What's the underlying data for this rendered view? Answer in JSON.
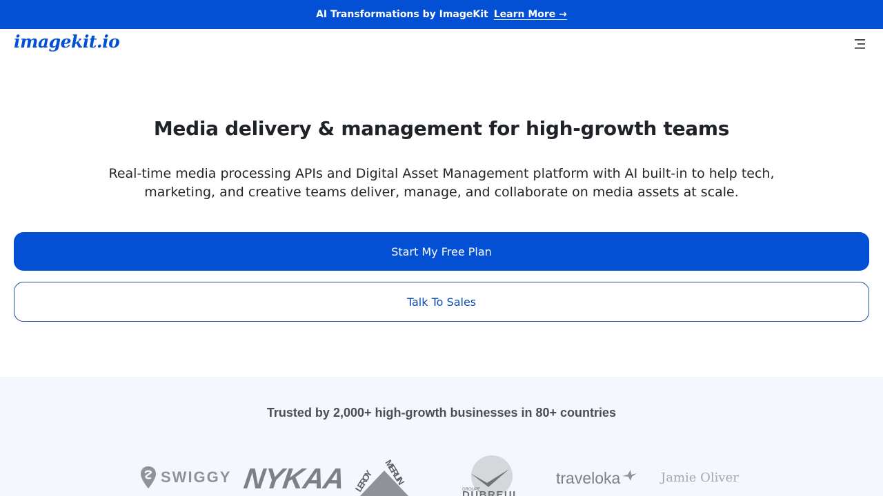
{
  "announcement": {
    "text": "AI Transformations by ImageKit",
    "link_label": "Learn More →"
  },
  "nav": {
    "logo_text": "imagekit.io",
    "menu_icon": "hamburger-menu-icon"
  },
  "hero": {
    "title": "Media delivery & management for high-growth teams",
    "subtitle": "Real-time media processing APIs and Digital Asset Management platform with AI built-in to help tech, marketing, and creative teams deliver, manage, and collaborate on media assets at scale."
  },
  "cta": {
    "primary_label": "Start My Free Plan",
    "secondary_label": "Talk To Sales"
  },
  "trusted": {
    "title": "Trusted by 2,000+ high-growth businesses in 80+ countries",
    "logos": [
      {
        "name": "SWIGGY"
      },
      {
        "name": "NYKAA"
      },
      {
        "name": "LEROY MERLIN"
      },
      {
        "name": "DUBREUIL",
        "caption": "GROUPE"
      },
      {
        "name": "traveloka"
      },
      {
        "name": "Jamie Oliver"
      }
    ]
  },
  "colors": {
    "brand_blue": "#0450d5",
    "trusted_bg": "#f4f7fd",
    "logo_gray": "#8a8d91"
  }
}
